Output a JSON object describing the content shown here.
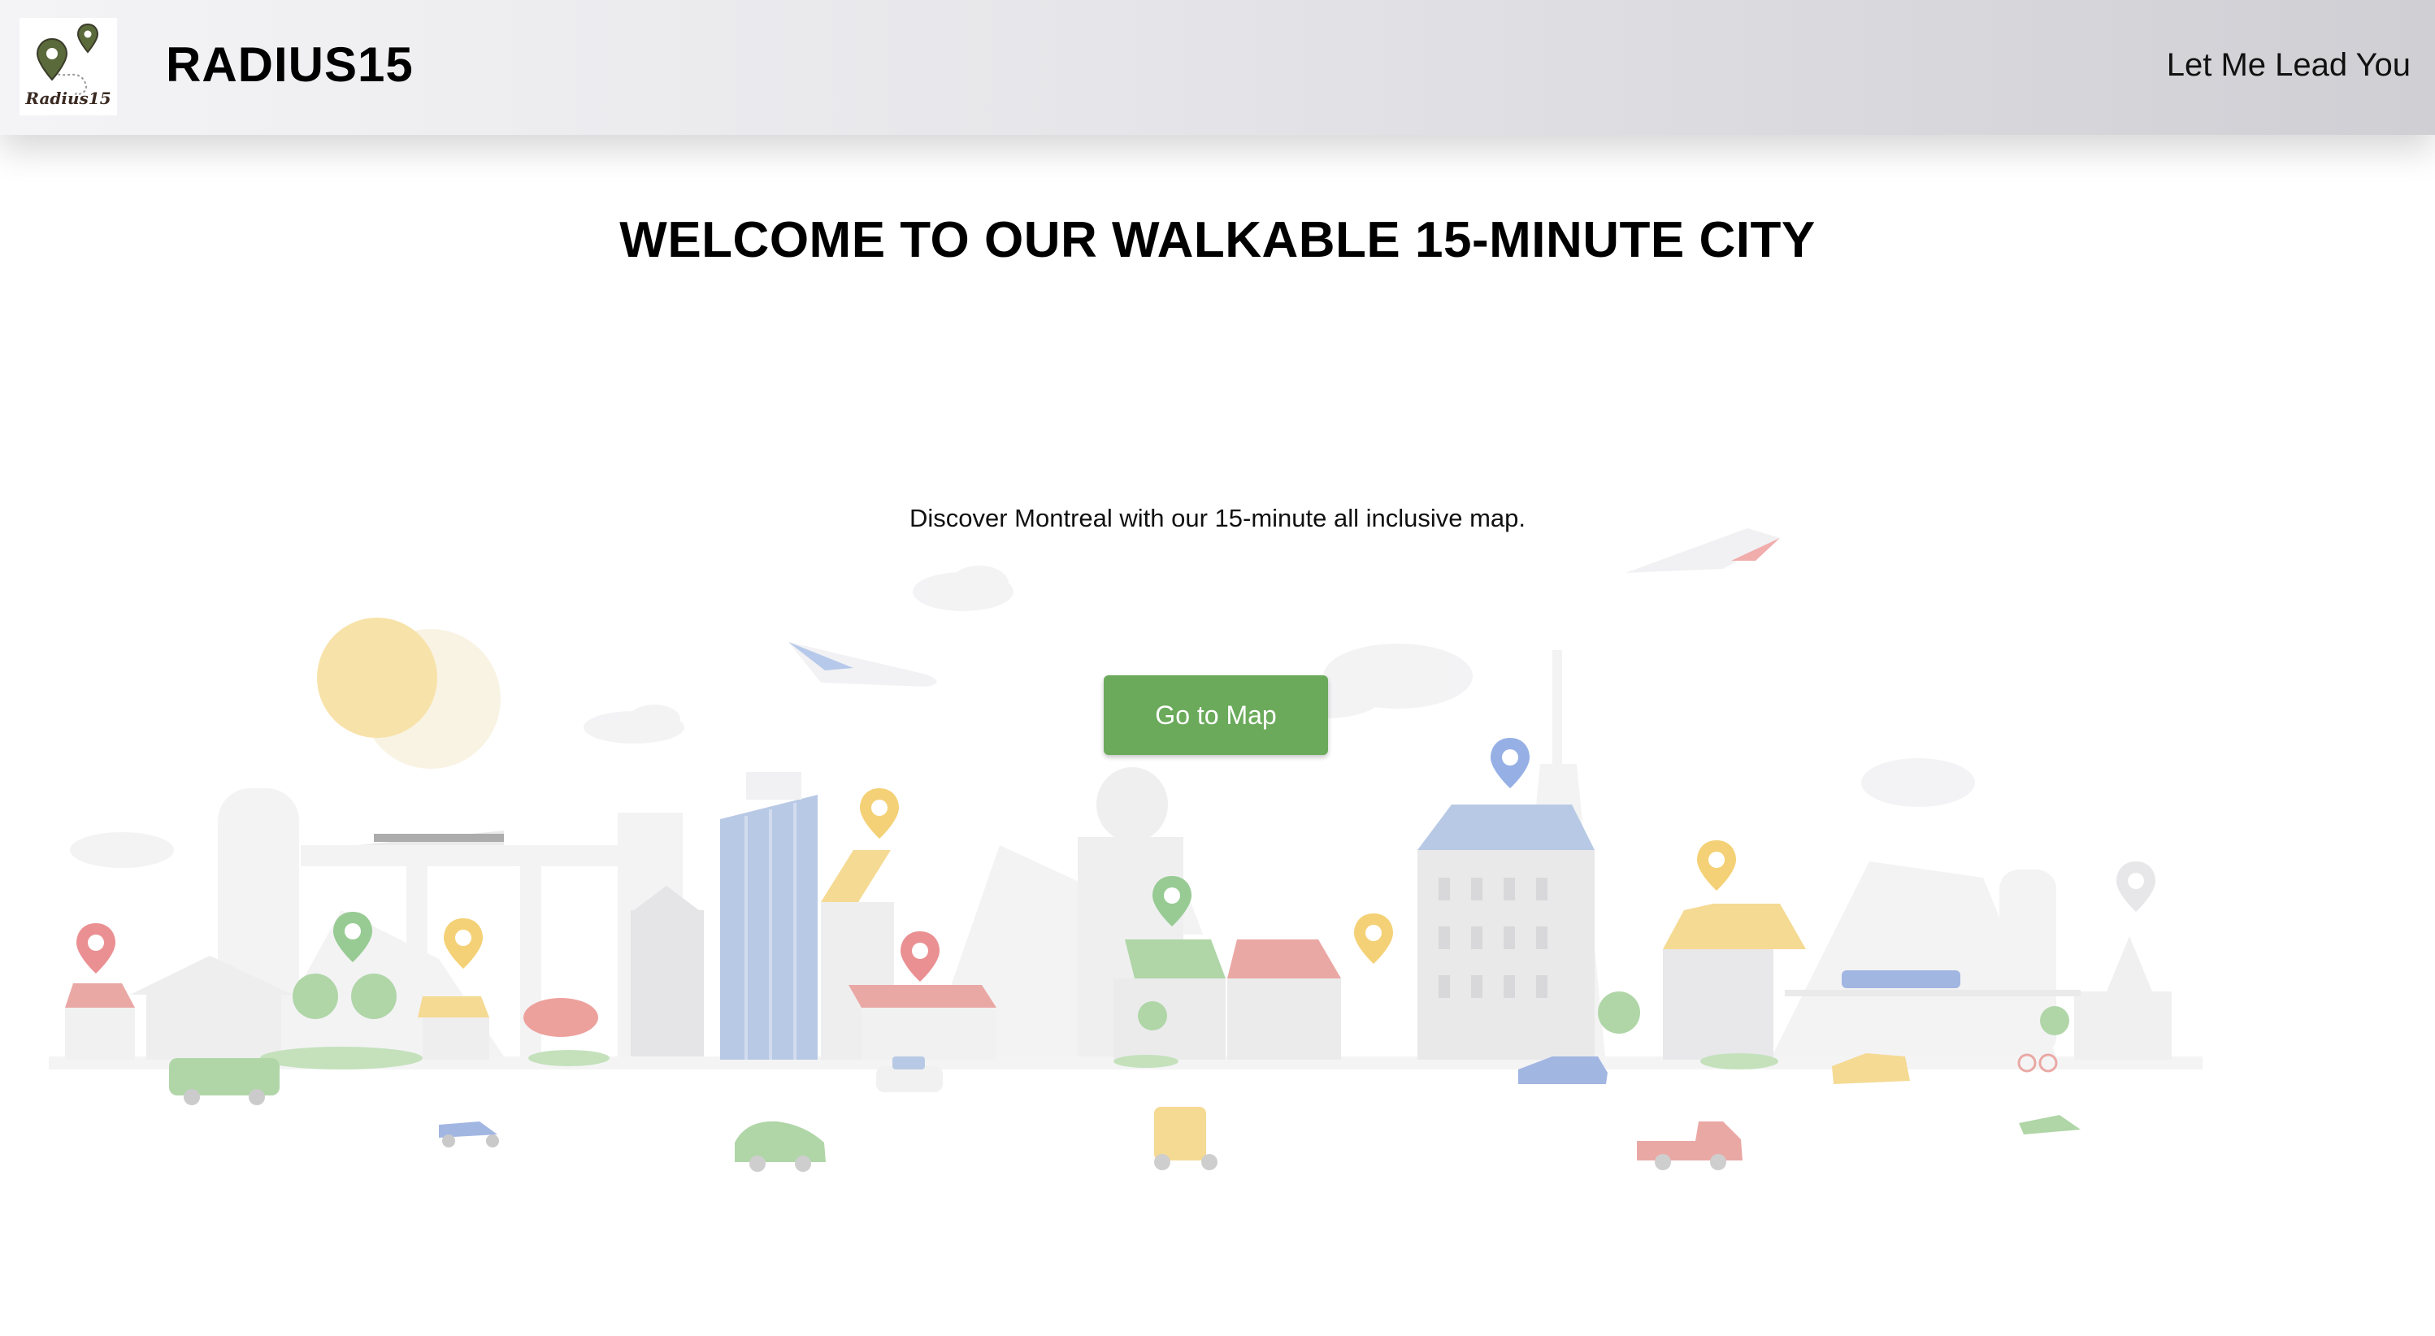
{
  "header": {
    "logo_text": "Radius15",
    "brand": "RADIUS15",
    "nav_link": "Let Me Lead You"
  },
  "hero": {
    "title": "WELCOME TO OUR WALKABLE 15-MINUTE CITY",
    "subtitle": "Discover Montreal with our 15-minute all inclusive map.",
    "cta_label": "Go to Map"
  },
  "colors": {
    "cta": "#6aaa5a",
    "accent_blue": "#a9bde0",
    "accent_yellow": "#f4d27a",
    "accent_red": "#e59490",
    "accent_green": "#9fce95"
  }
}
